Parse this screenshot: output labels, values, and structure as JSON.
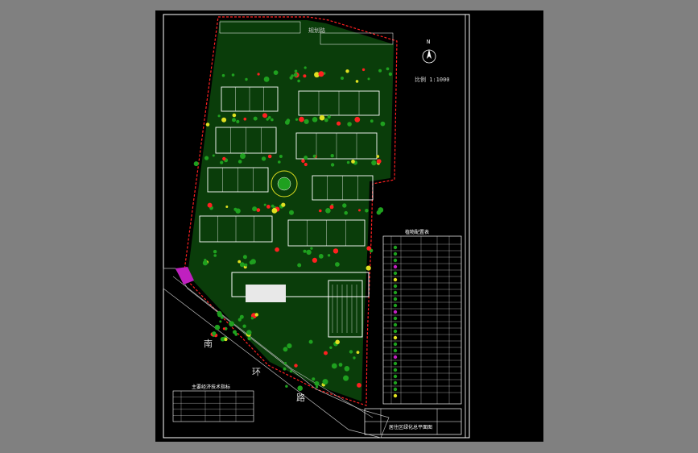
{
  "drawing": {
    "north_label": "N",
    "scale_label": "比例  1:1000",
    "road_top_label": "规划路",
    "road_bottom_label_1": "南",
    "road_bottom_label_2": "环",
    "road_bottom_label_3": "路",
    "plant_table_title": "植物配置表",
    "econ_table_title": "主要经济技术指标",
    "title_block_text": "居住区绿化总平面图"
  },
  "colors": {
    "background": "#000000",
    "frame": "#ffffff",
    "boundary": "#ff2020",
    "green": "#1fa01f",
    "building": "#ffffff",
    "accent_magenta": "#c020c0",
    "accent_yellow": "#e0e020"
  }
}
